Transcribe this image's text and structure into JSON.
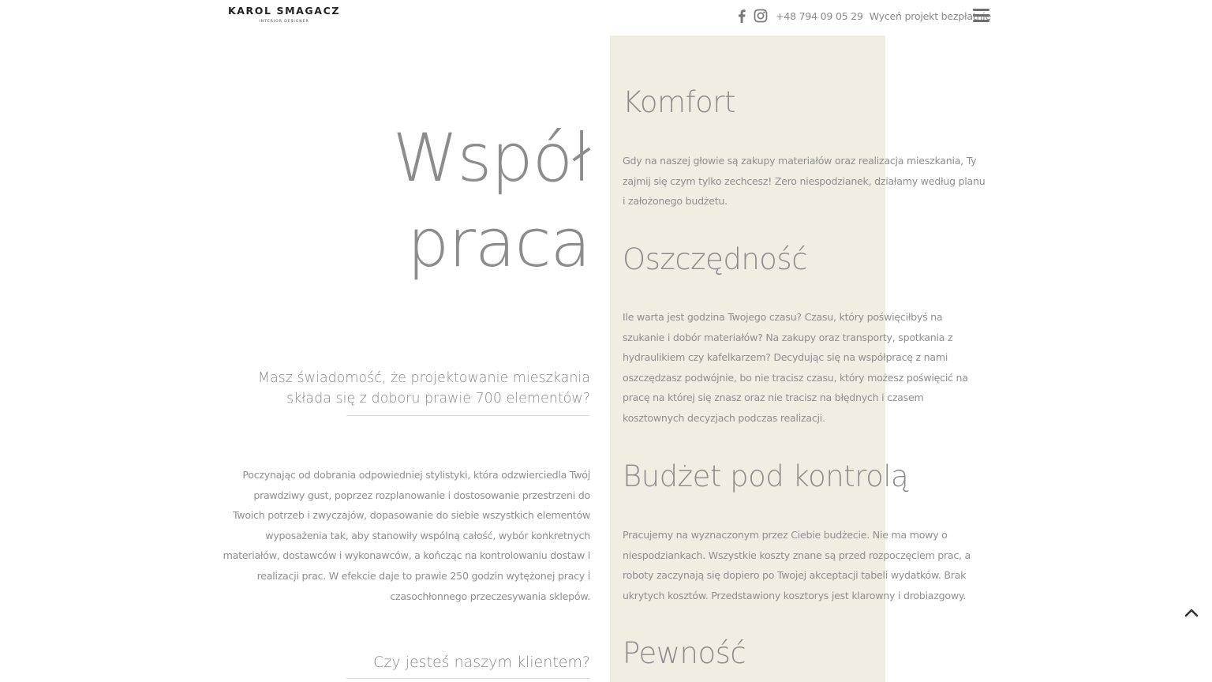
{
  "header": {
    "logo_name": "KAROL SMAGACZ",
    "logo_subtitle": "INTERIOR DESIGNER",
    "phone": "+48 794 09 05 29",
    "quote_link": "Wyceń projekt bezpłatnie",
    "icons": [
      "facebook-icon",
      "instagram-icon",
      "hamburger-menu-icon"
    ]
  },
  "left": {
    "title_line1": "Współ",
    "title_line2": "praca",
    "question": "Masz świadomość, że projektowanie mieszkania składa się z doboru prawie 700 elementów?",
    "intro": "Poczynając od dobrania odpowiedniej stylistyki, która odzwierciedla Twój prawdziwy gust, poprzez rozplanowanie i dostosowanie przestrzeni do Twoich potrzeb i zwyczajów, dopasowanie do siebie wszystkich elementów wyposażenia tak, aby stanowiły wspólną całość, wybór konkretnych materiałów, dostawców i wykonawców, a kończąc na kontrolowaniu dostaw i realizacji prac. W efekcie daje to prawie 250 godzin wytężonej pracy i czasochłonnego przeczesywania sklepów.",
    "client_question": "Czy jesteś naszym klientem?"
  },
  "features": [
    {
      "title": "Komfort",
      "text": "Gdy na naszej głowie są zakupy materiałów oraz realizacja mieszkania, Ty zajmij się czym tylko zechcesz! Zero niespodzianek, działamy według planu i założonego budżetu."
    },
    {
      "title": "Oszczędność",
      "text": "Ile warta jest godzina Twojego czasu? Czasu, który poświęciłbyś na szukanie i dobór materiałów? Na zakupy oraz transporty, spotkania z hydraulikiem czy kafelkarzem? Decydując się na współpracę z nami oszczędzasz podwójnie, bo nie tracisz czasu, który możesz poświęcić na pracę na której się znasz oraz nie tracisz na błędnych i czasem kosztownych decyzjach podczas realizacji."
    },
    {
      "title": "Budżet pod kontrolą",
      "text": "Pracujemy na wyznaczonym przez Ciebie budżecie. Nie ma mowy o niespodziankach. Wszystkie koszty znane są przed rozpoczęciem prac, a roboty zaczynają się dopiero po Twojej akceptacji tabeli wydatków. Brak ukrytych kosztów. Przedstawiony kosztorys jest klarowny i drobiazgowy."
    },
    {
      "title": "Pewność",
      "text": ""
    }
  ],
  "colors": {
    "accent_beige": "#f0ede2",
    "text_gray": "#8a8a8a",
    "logo_dark": "#222222"
  }
}
